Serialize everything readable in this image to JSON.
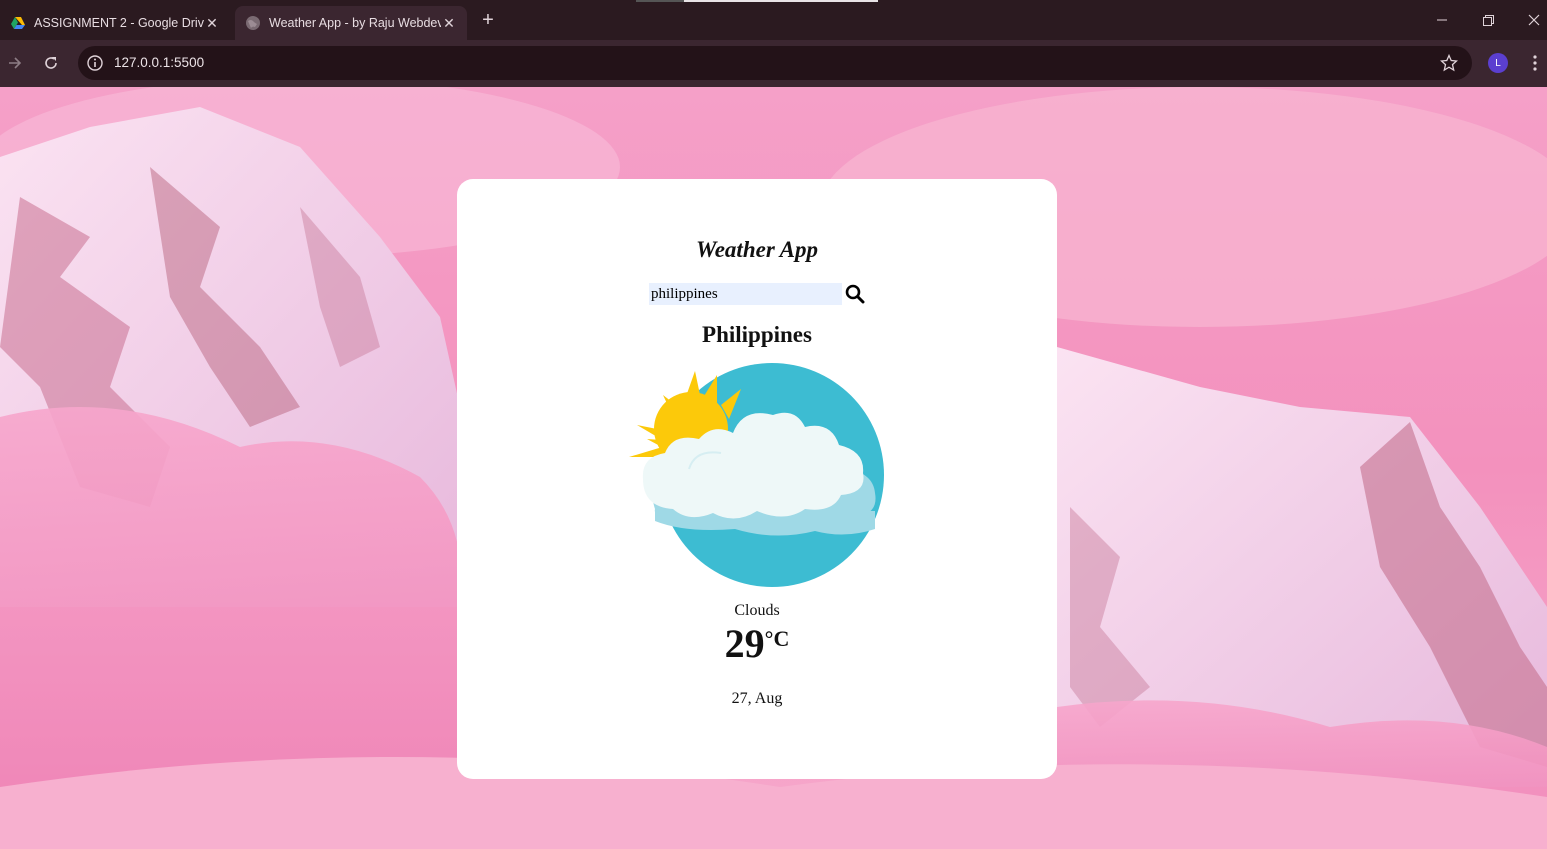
{
  "browser": {
    "tabs": [
      {
        "title": "ASSIGNMENT 2 - Google Drive",
        "favicon": "google-drive-icon",
        "active": false
      },
      {
        "title": "Weather App - by Raju Webdev",
        "favicon": "globe-icon",
        "active": true
      }
    ],
    "url": "127.0.0.1:5500",
    "profile_initial": "L"
  },
  "app": {
    "title": "Weather App",
    "search": {
      "value": "philippines"
    },
    "city": "Philippines",
    "weather_icon": "sun-behind-clouds-icon",
    "condition": "Clouds",
    "temperature": "29",
    "temperature_unit": "°C",
    "date": "27, Aug"
  },
  "colors": {
    "card": "#ffffff",
    "input_bg": "#e8f0fe",
    "background_pink": "#f3a2c8",
    "sky_circle": "#3dbcd2",
    "sun": "#fcc90a"
  }
}
